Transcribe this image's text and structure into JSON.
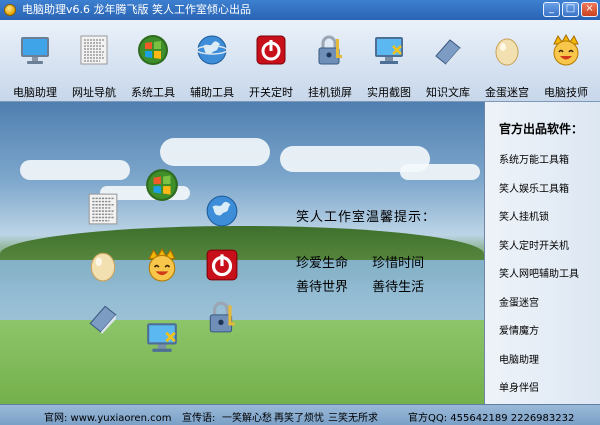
{
  "window": {
    "title": "电脑助理v6.6  龙年腾飞版   笑人工作室倾心出品",
    "buttons": {
      "minimize": "_",
      "maximize": "□",
      "close": "×"
    }
  },
  "toolbar": {
    "items": [
      {
        "label": "电脑助理",
        "icon": "monitor-icon"
      },
      {
        "label": "网址导航",
        "icon": "noise-grid-icon"
      },
      {
        "label": "系统工具",
        "icon": "windows-logo-icon"
      },
      {
        "label": "辅助工具",
        "icon": "globe-icon"
      },
      {
        "label": "开关定时",
        "icon": "power-icon"
      },
      {
        "label": "挂机锁屏",
        "icon": "padlock-icon"
      },
      {
        "label": "实用截图",
        "icon": "screen-capture-icon"
      },
      {
        "label": "知识文库",
        "icon": "book-icon"
      },
      {
        "label": "金蛋迷宫",
        "icon": "egg-icon"
      },
      {
        "label": "电脑技师",
        "icon": "smiley-face-icon"
      }
    ]
  },
  "message": {
    "title": "笑人工作室温馨提示：",
    "line1": [
      "珍爱生命",
      "珍惜时间"
    ],
    "line2": [
      "善待世界",
      "善待生活"
    ]
  },
  "side": {
    "title": "官方出品软件：",
    "items": [
      "系统万能工具箱",
      "笑人娱乐工具箱",
      "笑人挂机锁",
      "笑人定时开关机",
      "笑人网吧辅助工具",
      "金蛋迷宫",
      "爱情魔方",
      "电脑助理",
      "单身伴侣"
    ]
  },
  "status": {
    "site": "官网: www.yuxiaoren.com",
    "slogan_label": "宣传语:",
    "slogans": [
      "一笑解心愁",
      "再笑了烦忧",
      "三笑无所求"
    ],
    "qq": "官方QQ: 455642189   2226983232"
  },
  "colors": {
    "titlebar": "#2a64b4",
    "toolbar": "#d6e2f0",
    "side_panel": "#e6edf5",
    "status_bar": "#8fb0d2"
  }
}
